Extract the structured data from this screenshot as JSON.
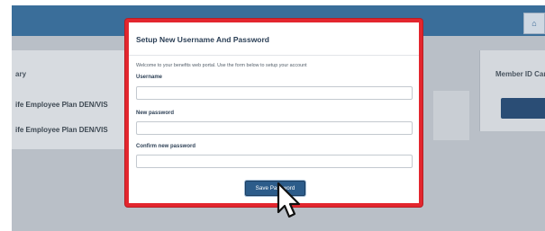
{
  "background": {
    "left_panel": {
      "title": "ary",
      "rows": [
        "ife Employee Plan DEN/VIS",
        "ife Employee Plan DEN/VIS"
      ]
    },
    "right_panel": {
      "title": "Member ID Card"
    },
    "home_icon": "home-icon"
  },
  "modal": {
    "title": "Setup New Username And Password",
    "intro": "Welcome to your benefits web portal. Use the form below to setup your account",
    "fields": [
      {
        "label": "Username",
        "value": "",
        "placeholder": ""
      },
      {
        "label": "New password",
        "value": "",
        "placeholder": ""
      },
      {
        "label": "Confirm new password",
        "value": "",
        "placeholder": ""
      }
    ],
    "save_label": "Save Password",
    "highlight_color": "#e3262e"
  },
  "cursor_icon": "mouse-pointer-icon"
}
